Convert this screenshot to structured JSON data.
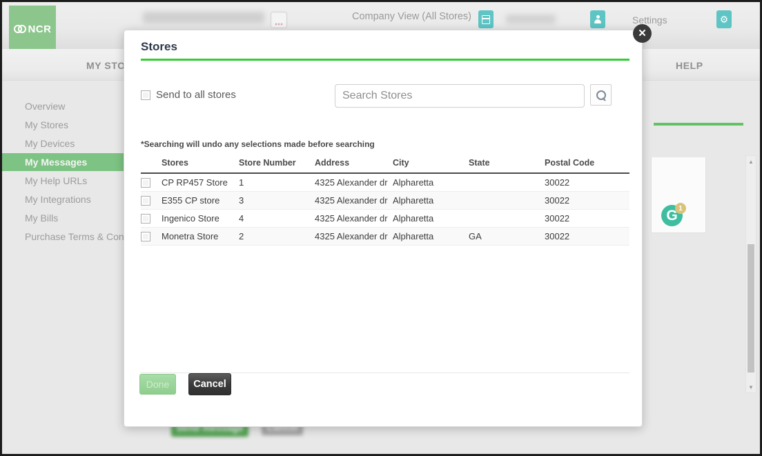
{
  "colors": {
    "brand_green": "#33cc33",
    "logo_green": "#8dc68d",
    "active_sidebar_green": "#7dc383",
    "teal_icon": "#5ec4c4",
    "badge_teal": "#3fbda0",
    "badge_count": "#d9c37a",
    "cancel_dark": "#3b3b3b",
    "title_navy": "#2f3a4a"
  },
  "topbar": {
    "logo_word": "NCR",
    "logo_icon": "ncr-links-logo-icon",
    "blurred_page_title": "",
    "dots_button_label": "...",
    "company_view": "Company View (All Stores)",
    "card_icon": "card-icon",
    "person_icon": "person-icon",
    "blurred_user_name": "",
    "settings_label": "Settings",
    "gear_icon": "gear-icon"
  },
  "nav": {
    "items": [
      {
        "label": "MY STO",
        "name": "nav-my-stores"
      },
      {
        "label": "HELP",
        "name": "nav-help"
      }
    ]
  },
  "sidebar": {
    "items": [
      {
        "label": "Overview",
        "active": false
      },
      {
        "label": "My Stores",
        "active": false
      },
      {
        "label": "My Devices",
        "active": false
      },
      {
        "label": "My Messages",
        "active": true
      },
      {
        "label": "My Help URLs",
        "active": false
      },
      {
        "label": "My Integrations",
        "active": false
      },
      {
        "label": "My Bills",
        "active": false
      },
      {
        "label": "Purchase Terms & Condit",
        "active": false
      }
    ]
  },
  "background_page": {
    "badge": {
      "letter": "G",
      "count": "1"
    },
    "buttons": [
      {
        "label": "Send message",
        "name": "send-message-button"
      },
      {
        "label": "Cancel",
        "name": "background-cancel-button"
      }
    ],
    "scrollbar": {
      "up_arrow": "▲",
      "down_arrow": "▼"
    }
  },
  "modal": {
    "title": "Stores",
    "close_icon": "close-icon",
    "send_to_all": {
      "label": "Send to all stores",
      "checked": false
    },
    "search": {
      "value": "",
      "placeholder": "Search Stores",
      "button_icon": "search-icon"
    },
    "note": "*Searching will undo any selections made before searching",
    "table": {
      "columns": [
        "",
        "Stores",
        "Store Number",
        "Address",
        "City",
        "State",
        "Postal Code"
      ],
      "rows": [
        {
          "checked": false,
          "store": "CP RP457 Store",
          "number": "1",
          "address": "4325 Alexander dr",
          "city": "Alpharetta",
          "state": "",
          "postal": "30022"
        },
        {
          "checked": false,
          "store": "E355 CP store",
          "number": "3",
          "address": "4325 Alexander dr",
          "city": "Alpharetta",
          "state": "",
          "postal": "30022"
        },
        {
          "checked": false,
          "store": "Ingenico Store",
          "number": "4",
          "address": "4325 Alexander dr",
          "city": "Alpharetta",
          "state": "",
          "postal": "30022"
        },
        {
          "checked": false,
          "store": "Monetra Store",
          "number": "2",
          "address": "4325 Alexander dr",
          "city": "Alpharetta",
          "state": "GA",
          "postal": "30022"
        }
      ]
    },
    "footer": {
      "done_label": "Done",
      "done_disabled": true,
      "cancel_label": "Cancel"
    }
  }
}
